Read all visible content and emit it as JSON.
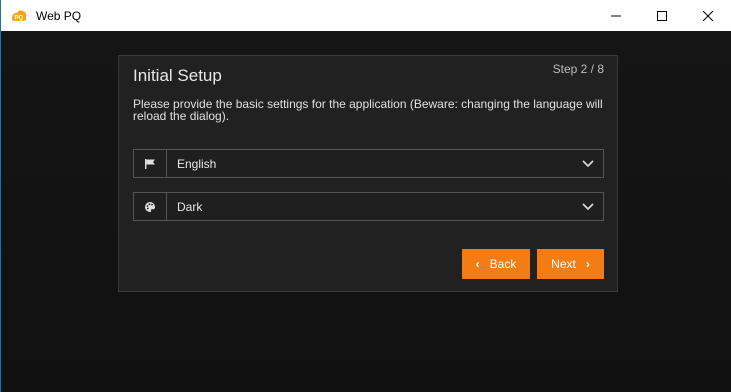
{
  "window": {
    "title": "Web PQ",
    "logo_text": "PQ",
    "accent_color": "#f47c14",
    "frame_color": "#1a6fb5"
  },
  "dialog": {
    "step": "Step 2 / 8",
    "title": "Initial Setup",
    "description": "Please provide the basic settings for the application (Beware: changing the language will reload the dialog).",
    "language": {
      "icon": "flag-icon",
      "value": "English"
    },
    "theme": {
      "icon": "palette-icon",
      "value": "Dark"
    },
    "back_label": "Back",
    "next_label": "Next"
  }
}
